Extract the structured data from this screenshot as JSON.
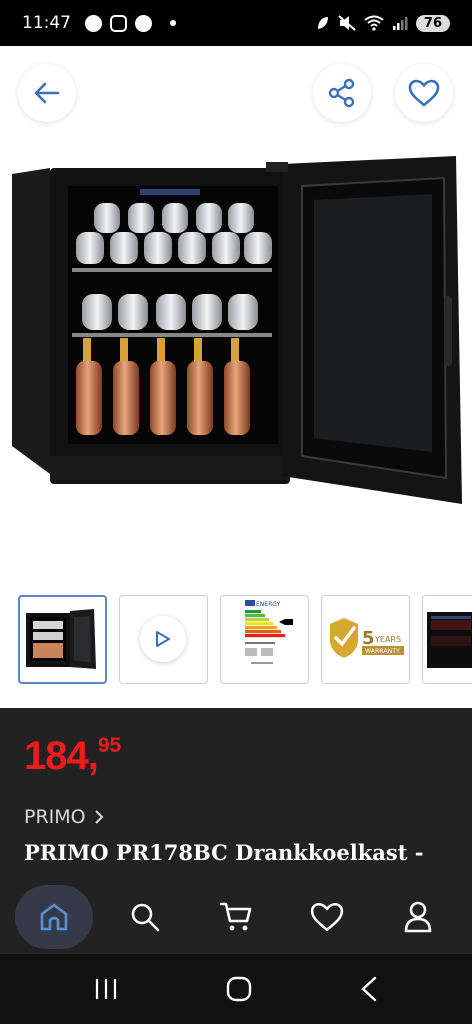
{
  "status_bar": {
    "time": "11:47",
    "battery": "76",
    "icons": [
      "facebook-icon",
      "instagram-icon",
      "facebook-icon",
      "notification-dot",
      "leaf-icon",
      "mute-icon",
      "wifi-icon",
      "signal-icon",
      "battery-icon"
    ]
  },
  "header": {
    "back_icon": "arrow-left-icon",
    "share_icon": "share-icon",
    "favorite_icon": "heart-icon"
  },
  "gallery": {
    "thumbnails": [
      {
        "type": "image",
        "icon": "fridge-front-image"
      },
      {
        "type": "video",
        "icon": "play-icon"
      },
      {
        "type": "image",
        "icon": "energy-label-image"
      },
      {
        "type": "image",
        "icon": "warranty-badge-image",
        "text_big": "5",
        "text_years": "YEARS",
        "text_warranty": "WARRANTY"
      },
      {
        "type": "image",
        "icon": "fridge-side-image"
      }
    ],
    "energy_label_heading": "ENERGY"
  },
  "product": {
    "price_main": "184,",
    "price_cents": "95",
    "brand": "PRIMO",
    "title": "PRIMO PR178BC Drankkoelkast -"
  },
  "bottom_nav": [
    {
      "name": "home",
      "icon": "home-icon",
      "active": true
    },
    {
      "name": "search",
      "icon": "search-icon",
      "active": false
    },
    {
      "name": "cart",
      "icon": "cart-icon",
      "active": false
    },
    {
      "name": "wishlist",
      "icon": "heart-icon",
      "active": false
    },
    {
      "name": "account",
      "icon": "user-icon",
      "active": false
    }
  ],
  "colors": {
    "accent_blue": "#3d6fb6",
    "price_red": "#ef1c1c",
    "dark_panel": "#222222"
  }
}
